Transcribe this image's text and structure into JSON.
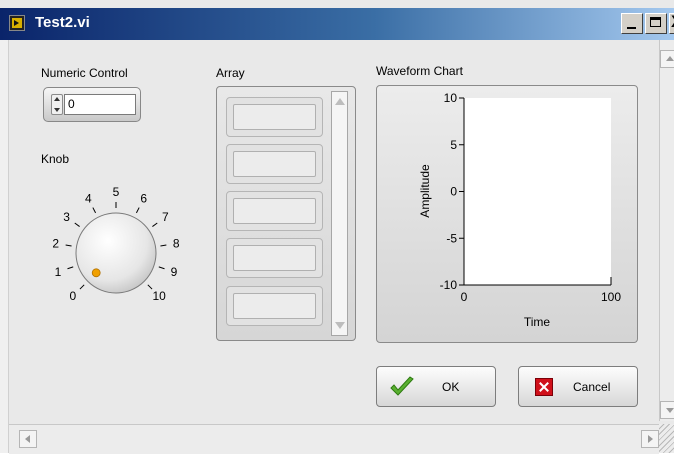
{
  "window": {
    "title": "Test2.vi",
    "close_glyph": "X"
  },
  "numeric_control": {
    "label": "Numeric Control",
    "value": "0"
  },
  "knob": {
    "label": "Knob",
    "min": 0,
    "max": 10,
    "value": 0,
    "ticks": [
      "0",
      "1",
      "2",
      "3",
      "4",
      "5",
      "6",
      "7",
      "8",
      "9",
      "10"
    ]
  },
  "array": {
    "label": "Array",
    "visible_elements": 5
  },
  "chart": {
    "label": "Waveform Chart"
  },
  "chart_data": {
    "type": "line",
    "title": "Waveform Chart",
    "xlabel": "Time",
    "ylabel": "Amplitude",
    "xlim": [
      0,
      100
    ],
    "ylim": [
      -10,
      10
    ],
    "x_ticks": [
      "0",
      "100"
    ],
    "y_ticks": [
      "10",
      "5",
      "0",
      "-5",
      "-10"
    ],
    "series": []
  },
  "buttons": {
    "ok": "OK",
    "cancel": "Cancel"
  },
  "colors": {
    "title_start": "#0a246a",
    "title_end": "#a6caf0",
    "accent_check": "#5ab031",
    "cancel_red": "#d0101a",
    "knob_dot": "#f0a000"
  }
}
